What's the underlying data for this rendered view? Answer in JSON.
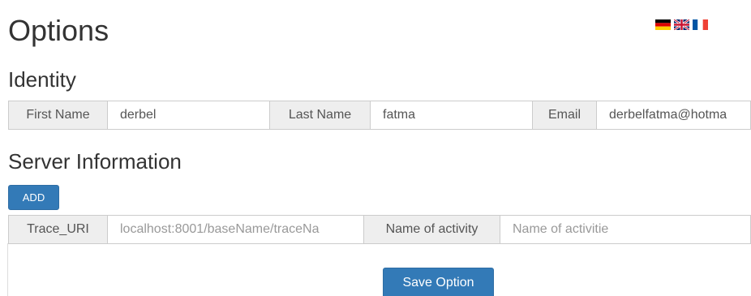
{
  "title": "Options",
  "languages": [
    {
      "name": "German",
      "icon": "flag-de-icon"
    },
    {
      "name": "English (UK)",
      "icon": "flag-uk-icon"
    },
    {
      "name": "French",
      "icon": "flag-fr-icon"
    }
  ],
  "identity": {
    "heading": "Identity",
    "first_name_label": "First Name",
    "first_name_value": "derbel",
    "last_name_label": "Last Name",
    "last_name_value": "fatma",
    "email_label": "Email",
    "email_value": "derbelfatma@hotma"
  },
  "server": {
    "heading": "Server Information",
    "add_label": "ADD",
    "trace_uri_label": "Trace_URI",
    "trace_uri_placeholder": "localhost:8001/baseName/traceNa",
    "activity_label": "Name of activity",
    "activity_placeholder": "Name of activitie"
  },
  "save_label": "Save Option",
  "colors": {
    "primary": "#337ab7",
    "addon_bg": "#eeeeee",
    "border": "#cccccc",
    "text": "#333333"
  }
}
